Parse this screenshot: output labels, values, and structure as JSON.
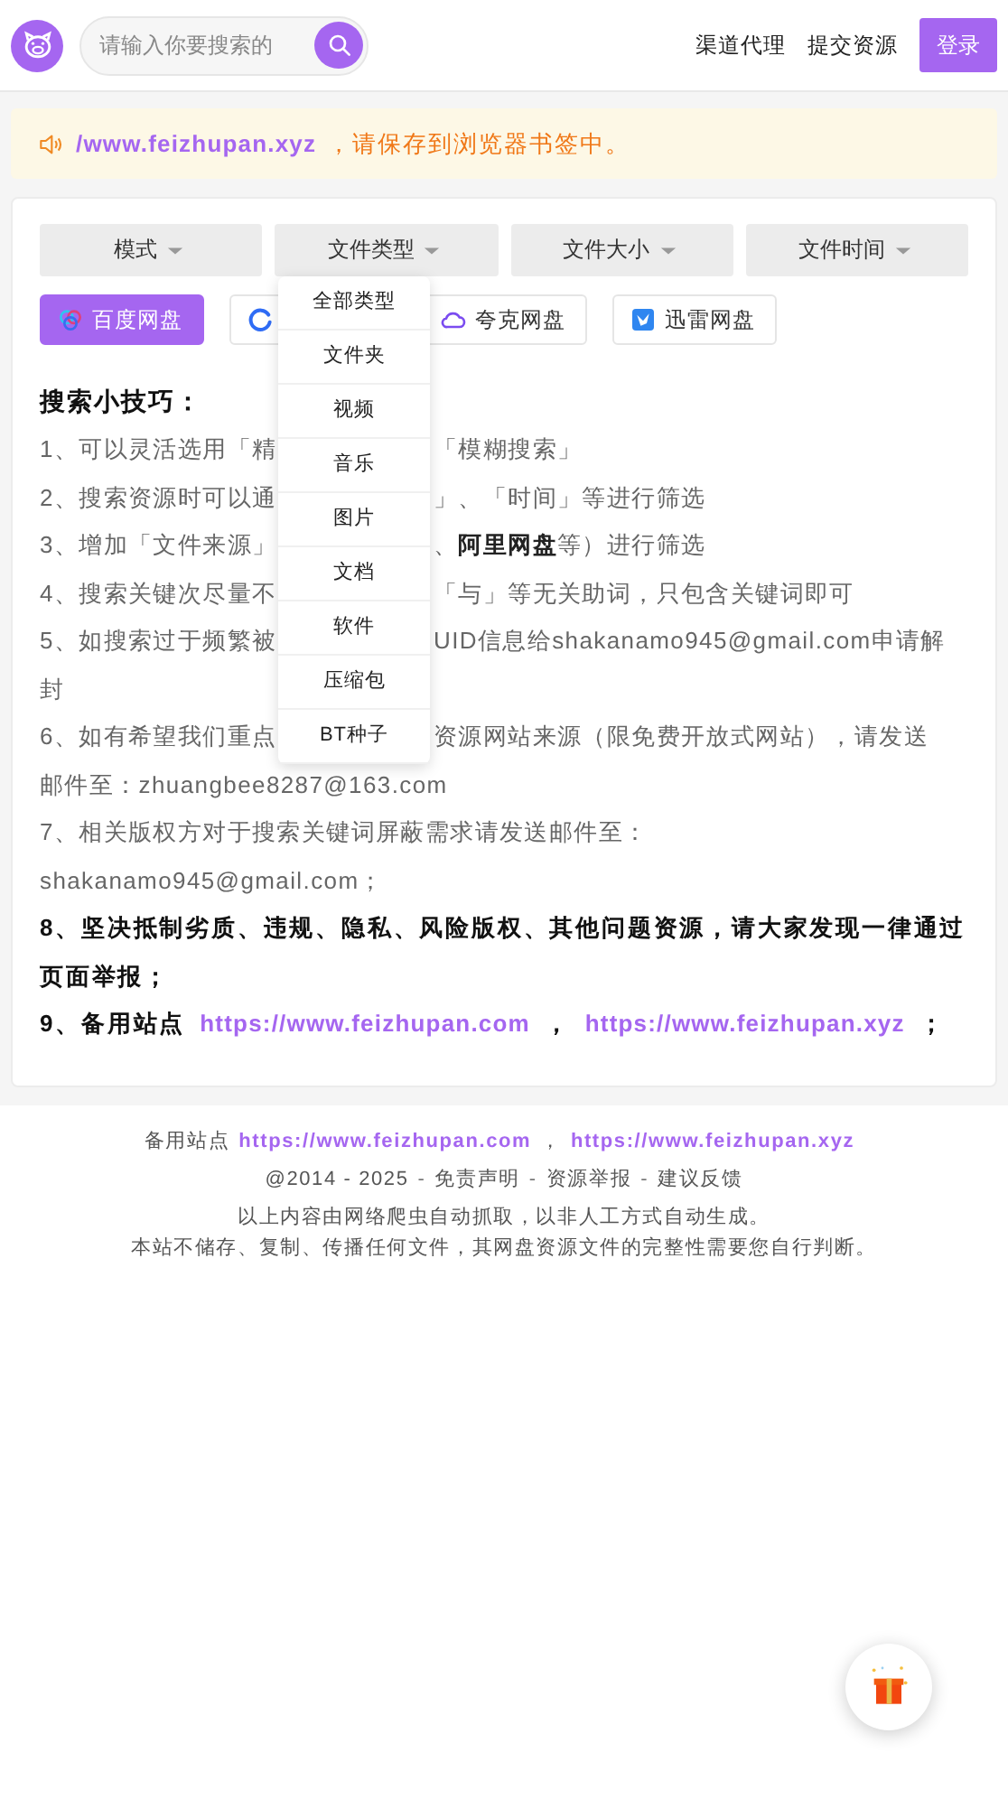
{
  "header": {
    "search": {
      "placeholder": "请输入你要搜索的"
    },
    "nav_links": [
      "渠道代理",
      "提交资源"
    ],
    "login_button": "登录"
  },
  "notice": {
    "link": "/www.feizhupan.xyz",
    "text": "，请保存到浏览器书签中。"
  },
  "filters": [
    {
      "label": "模式"
    },
    {
      "label": "文件类型",
      "menu": [
        "全部类型",
        "文件夹",
        "视频",
        "音乐",
        "图片",
        "文档",
        "软件",
        "压缩包",
        "BT种子"
      ]
    },
    {
      "label": "文件大小"
    },
    {
      "label": "文件时间"
    }
  ],
  "sources": [
    {
      "label": "百度网盘",
      "kind": "rings",
      "selected": true
    },
    {
      "kind": "ring",
      "selected": false
    },
    {
      "label": "夸克网盘",
      "kind": "cloud",
      "selected": false
    },
    {
      "label": "迅雷网盘",
      "kind": "bird",
      "selected": false
    }
  ],
  "tips": {
    "title": "搜索小技巧：",
    "rows": [
      {
        "kind": "split",
        "left": "1、可以灵活选用「精",
        "right": "「模糊搜索」"
      },
      {
        "kind": "split",
        "left": "2、搜索资源时可以通",
        "right": "」、「时间」等进行筛选"
      },
      {
        "kind": "split",
        "left": "3、增加「文件来源」",
        "right": "、**阿里网盘**等）进行筛选"
      },
      {
        "kind": "split",
        "left": "4、搜索关键次尽量不",
        "right": "「与」等无关助词，只包含关键词即可"
      },
      {
        "kind": "split",
        "left": "5、如搜索过于频繁被",
        "right": "UID信息给shakanamo945@gmail.com申请解"
      },
      {
        "kind": "split",
        "left": "封"
      },
      {
        "kind": "split",
        "left": "6、如有希望我们重点",
        "right": "资源网站来源（限免费开放式网站），请发送"
      },
      {
        "kind": "plain",
        "text": "邮件至：zhuangbee8287@163.com"
      },
      {
        "kind": "plain",
        "text": "7、相关版权方对于搜索关键词屏蔽需求请发送邮件至："
      },
      {
        "kind": "plain",
        "text": "shakanamo945@gmail.com；"
      },
      {
        "kind": "bold",
        "text": "8、坚决抵制劣质、违规、隐私、风险版权、其他问题资源，请大家发现一律通过页面举报；"
      },
      {
        "kind": "links",
        "parts": [
          {
            "kind": "text",
            "text": "9、备用站点"
          },
          {
            "kind": "link",
            "text": "https://www.feizhupan.com"
          },
          {
            "kind": "text",
            "text": "，"
          },
          {
            "kind": "link",
            "text": "https://www.feizhupan.xyz"
          },
          {
            "kind": "text",
            "text": "；"
          }
        ]
      }
    ]
  },
  "footer": {
    "lines": [
      [
        {
          "kind": "text",
          "text": "备用站点"
        },
        {
          "kind": "link",
          "text": "https://www.feizhupan.com"
        },
        {
          "kind": "text",
          "text": "，"
        },
        {
          "kind": "link",
          "text": "https://www.feizhupan.xyz"
        }
      ],
      [
        {
          "kind": "text",
          "text": "@2014 - 2025"
        },
        {
          "kind": "sep",
          "text": "-"
        },
        {
          "kind": "nav",
          "text": "免责声明"
        },
        {
          "kind": "sep",
          "text": "-"
        },
        {
          "kind": "nav",
          "text": "资源举报"
        },
        {
          "kind": "sep",
          "text": "-"
        },
        {
          "kind": "nav",
          "text": "建议反馈"
        }
      ],
      [
        {
          "kind": "text",
          "text": "以上内容由网络爬虫自动抓取，以非人工方式自动生成。"
        }
      ],
      [
        {
          "kind": "text",
          "text": "本站不储存、复制、传播任何文件，其网盘资源文件的完整性需要您自行判断。"
        }
      ]
    ]
  }
}
